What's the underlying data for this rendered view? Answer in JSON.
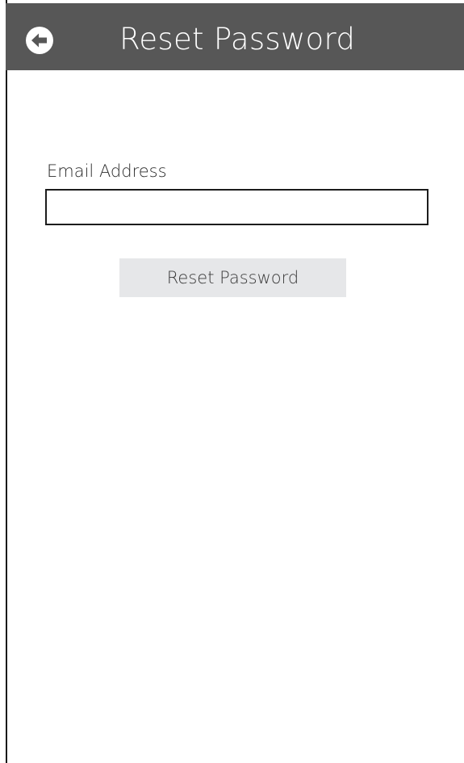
{
  "header": {
    "title": "Reset Password",
    "back_icon": "arrow-left-circle-icon",
    "background_color": "#575757"
  },
  "form": {
    "email_label": "Email Address",
    "email_value": "",
    "email_placeholder": "",
    "submit_label": "Reset Password",
    "submit_background": "#e6e7e9"
  }
}
